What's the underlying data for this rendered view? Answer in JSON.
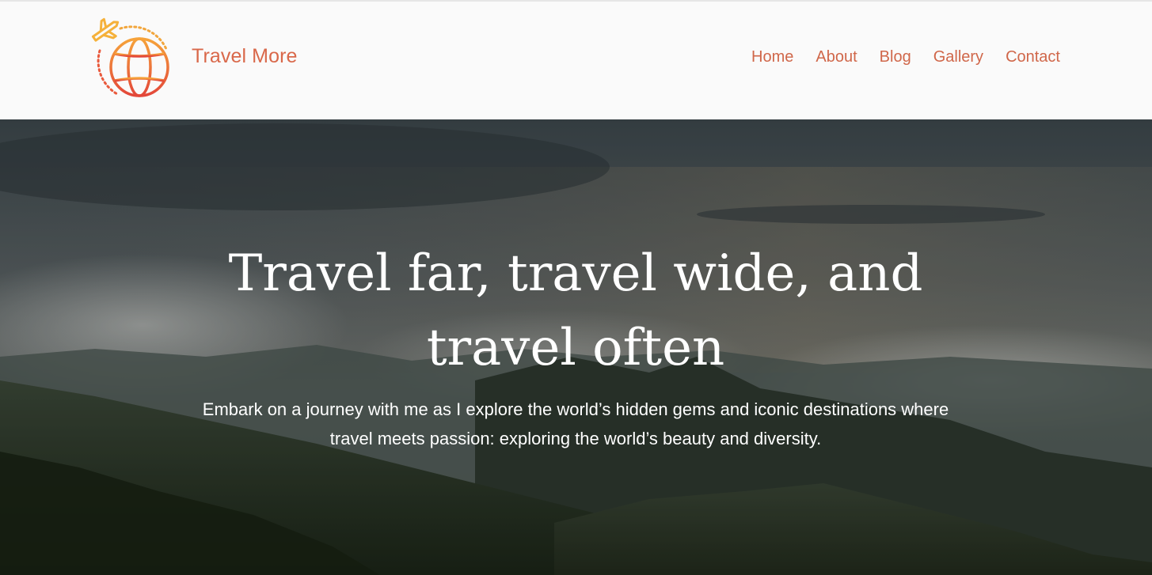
{
  "header": {
    "brand": "Travel More",
    "logo_icon": "globe-plane-icon",
    "nav": [
      {
        "label": "Home"
      },
      {
        "label": "About"
      },
      {
        "label": "Blog"
      },
      {
        "label": "Gallery"
      },
      {
        "label": "Contact"
      }
    ]
  },
  "hero": {
    "title_line1": "Travel far, travel wide, and",
    "title_line2": "travel often",
    "subtitle": "Embark on a journey with me as I explore the world’s hidden gems and iconic destinations where travel meets passion: exploring the world’s beauty and diversity.",
    "background": "mountain-landscape-image"
  },
  "colors": {
    "brand": "#d9684a",
    "header_bg": "#fafafa",
    "hero_text": "#ffffff"
  }
}
